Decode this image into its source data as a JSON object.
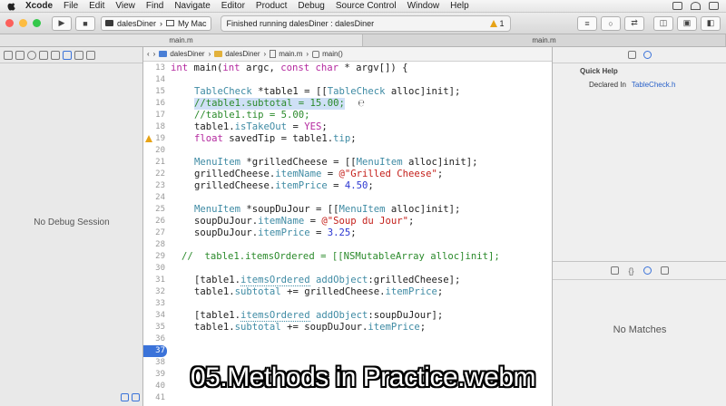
{
  "menubar": {
    "app": "Xcode",
    "menus": [
      "File",
      "Edit",
      "View",
      "Find",
      "Navigate",
      "Editor",
      "Product",
      "Debug",
      "Source Control",
      "Window",
      "Help"
    ]
  },
  "toolbar": {
    "scheme_target": "dalesDiner",
    "scheme_device": "My Mac",
    "activity_text": "Finished running dalesDiner : dalesDiner",
    "warning_count": "1"
  },
  "tabs": [
    "main.m",
    "main.m"
  ],
  "navigator": {
    "empty_text": "No Debug Session"
  },
  "jumpbar": {
    "items": [
      "dalesDiner",
      "dalesDiner",
      "main.m",
      "main()"
    ]
  },
  "code": {
    "current_line": "37",
    "warning_line": "19",
    "lines": [
      {
        "n": "13",
        "t": "int main(int argc, const char * argv[]) {"
      },
      {
        "n": "14",
        "t": ""
      },
      {
        "n": "15",
        "t": "    TableCheck *table1 = [[TableCheck alloc]init];"
      },
      {
        "n": "16",
        "t": "    //table1.subtotal = 15.00;"
      },
      {
        "n": "17",
        "t": "    //table1.tip = 5.00;"
      },
      {
        "n": "18",
        "t": "    table1.isTakeOut = YES;"
      },
      {
        "n": "19",
        "t": "    float savedTip = table1.tip;"
      },
      {
        "n": "20",
        "t": ""
      },
      {
        "n": "21",
        "t": "    MenuItem *grilledCheese = [[MenuItem alloc]init];"
      },
      {
        "n": "22",
        "t": "    grilledCheese.itemName = @\"Grilled Cheese\";"
      },
      {
        "n": "23",
        "t": "    grilledCheese.itemPrice = 4.50;"
      },
      {
        "n": "24",
        "t": ""
      },
      {
        "n": "25",
        "t": "    MenuItem *soupDuJour = [[MenuItem alloc]init];"
      },
      {
        "n": "26",
        "t": "    soupDuJour.itemName = @\"Soup du Jour\";"
      },
      {
        "n": "27",
        "t": "    soupDuJour.itemPrice = 3.25;"
      },
      {
        "n": "28",
        "t": ""
      },
      {
        "n": "29",
        "t": "  //  table1.itemsOrdered = [[NSMutableArray alloc]init];"
      },
      {
        "n": "30",
        "t": ""
      },
      {
        "n": "31",
        "t": "    [table1.itemsOrdered addObject:grilledCheese];"
      },
      {
        "n": "32",
        "t": "    table1.subtotal += grilledCheese.itemPrice;"
      },
      {
        "n": "33",
        "t": ""
      },
      {
        "n": "34",
        "t": "    [table1.itemsOrdered addObject:soupDuJour];"
      },
      {
        "n": "35",
        "t": "    table1.subtotal += soupDuJour.itemPrice;"
      },
      {
        "n": "36",
        "t": ""
      },
      {
        "n": "37",
        "t": ""
      },
      {
        "n": "38",
        "t": ""
      },
      {
        "n": "39",
        "t": ""
      },
      {
        "n": "40",
        "t": ""
      },
      {
        "n": "41",
        "t": ""
      }
    ]
  },
  "inspector": {
    "quick_help_title": "Quick Help",
    "declared_in_label": "Declared In",
    "declared_in_value": "TableCheck.h",
    "library_empty": "No Matches"
  },
  "caption": "05.Methods in Practice.webm",
  "colors": {
    "keyword": "#b4299f",
    "class": "#3f8ba4",
    "number": "#2b36d1",
    "string": "#c4201b",
    "comment": "#2b8a2b",
    "accent": "#3b73d9"
  }
}
